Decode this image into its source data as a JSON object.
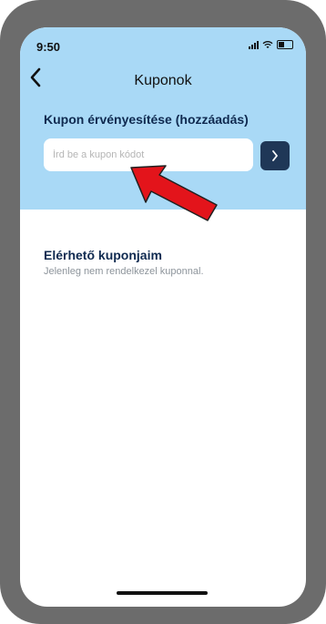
{
  "status_bar": {
    "time": "9:50"
  },
  "nav": {
    "back_icon": "chevron-left-icon",
    "title": "Kuponok"
  },
  "coupon_section": {
    "title": "Kupon érvényesítése (hozzáadás)",
    "input_placeholder": "Írd be a kupon kódot",
    "submit_icon": "chevron-right-icon"
  },
  "available_section": {
    "title": "Elérhető kuponjaim",
    "empty_text": "Jelenleg nem rendelkezel kuponnal."
  },
  "colors": {
    "header_bg": "#a9d9f6",
    "accent_dark": "#1f3757",
    "arrow_red": "#e3141b"
  }
}
